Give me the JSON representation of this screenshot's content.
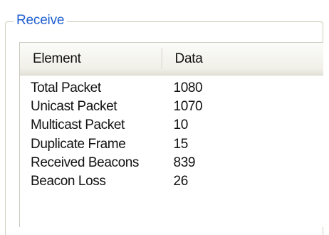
{
  "group": {
    "title": "Receive"
  },
  "table": {
    "columns": [
      "Element",
      "Data"
    ],
    "rows": [
      [
        "Total Packet",
        "1080"
      ],
      [
        "Unicast Packet",
        "1070"
      ],
      [
        "Multicast Packet",
        "10"
      ],
      [
        "Duplicate Frame",
        "15"
      ],
      [
        "Received Beacons",
        "839"
      ],
      [
        "Beacon Loss",
        "26"
      ]
    ]
  }
}
